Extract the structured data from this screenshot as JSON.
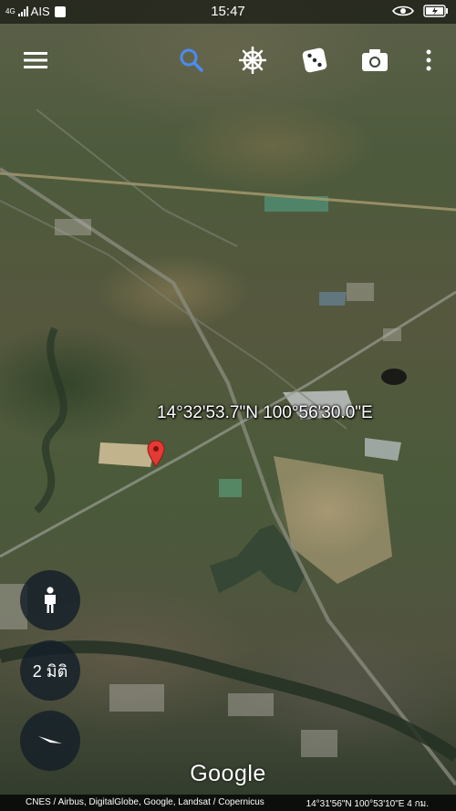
{
  "status_bar": {
    "carrier": "AIS",
    "network": "4G",
    "time": "15:47"
  },
  "toolbar": {
    "icons": [
      "menu-icon",
      "search-icon",
      "voyager-wheel-icon",
      "dice-icon",
      "camera-icon",
      "more-icon"
    ],
    "accent_color": "#4b8bf5"
  },
  "map": {
    "coordinates": "14°32'53.7\"N 100°56'30.0\"E",
    "pin_color": "#e53935"
  },
  "controls": {
    "view_label": "2 มิติ",
    "person_icon": "person-icon",
    "compass_icon": "compass-icon"
  },
  "branding": {
    "logo_text": "Google"
  },
  "footer": {
    "attribution": "CNES / Airbus, DigitalGlobe, Google, Landsat / Copernicus",
    "camera_info": "14°31'56\"N 100°53'10\"E 4 กม."
  }
}
